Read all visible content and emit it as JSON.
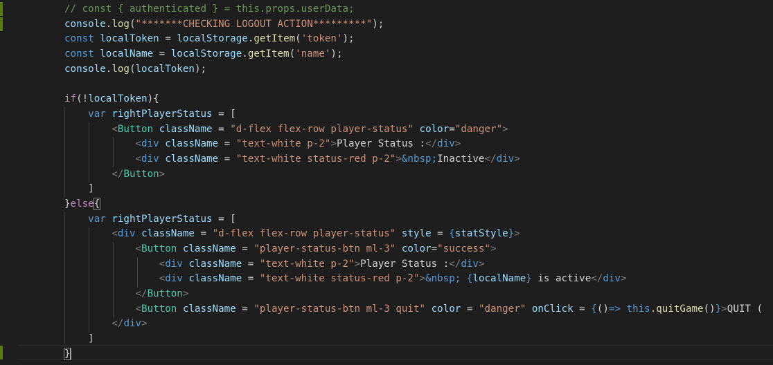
{
  "editor": {
    "language": "javascript-jsx",
    "lines": [
      {
        "indent": 0,
        "tokens": [
          {
            "c": "comment",
            "t": "// const { authenticated } = this.props.userData;"
          }
        ]
      },
      {
        "indent": 0,
        "tokens": [
          {
            "c": "var",
            "t": "console"
          },
          {
            "c": "punc",
            "t": "."
          },
          {
            "c": "fn",
            "t": "log"
          },
          {
            "c": "punc",
            "t": "("
          },
          {
            "c": "str",
            "t": "\"*******CHECKING LOGOUT ACTION*********\""
          },
          {
            "c": "punc",
            "t": ");"
          }
        ]
      },
      {
        "indent": 0,
        "tokens": [
          {
            "c": "kw",
            "t": "const"
          },
          {
            "c": "text",
            "t": " "
          },
          {
            "c": "var",
            "t": "localToken"
          },
          {
            "c": "punc",
            "t": " = "
          },
          {
            "c": "var",
            "t": "localStorage"
          },
          {
            "c": "punc",
            "t": "."
          },
          {
            "c": "fn",
            "t": "getItem"
          },
          {
            "c": "punc",
            "t": "("
          },
          {
            "c": "str",
            "t": "'token'"
          },
          {
            "c": "punc",
            "t": ");"
          }
        ]
      },
      {
        "indent": 0,
        "tokens": [
          {
            "c": "kw",
            "t": "const"
          },
          {
            "c": "text",
            "t": " "
          },
          {
            "c": "var",
            "t": "localName"
          },
          {
            "c": "punc",
            "t": " = "
          },
          {
            "c": "var",
            "t": "localStorage"
          },
          {
            "c": "punc",
            "t": "."
          },
          {
            "c": "fn",
            "t": "getItem"
          },
          {
            "c": "punc",
            "t": "("
          },
          {
            "c": "str",
            "t": "'name'"
          },
          {
            "c": "punc",
            "t": ");"
          }
        ]
      },
      {
        "indent": 0,
        "tokens": [
          {
            "c": "var",
            "t": "console"
          },
          {
            "c": "punc",
            "t": "."
          },
          {
            "c": "fn",
            "t": "log"
          },
          {
            "c": "punc",
            "t": "("
          },
          {
            "c": "var",
            "t": "localToken"
          },
          {
            "c": "punc",
            "t": ");"
          }
        ]
      },
      {
        "indent": 0,
        "tokens": []
      },
      {
        "indent": 0,
        "tokens": [
          {
            "c": "ctrl",
            "t": "if"
          },
          {
            "c": "punc",
            "t": "(!"
          },
          {
            "c": "var",
            "t": "localToken"
          },
          {
            "c": "punc",
            "t": "){"
          }
        ]
      },
      {
        "indent": 1,
        "tokens": [
          {
            "c": "kw",
            "t": "var"
          },
          {
            "c": "text",
            "t": " "
          },
          {
            "c": "var",
            "t": "rightPlayerStatus"
          },
          {
            "c": "punc",
            "t": " = ["
          }
        ]
      },
      {
        "indent": 2,
        "tokens": [
          {
            "c": "tagpunc",
            "t": "<"
          },
          {
            "c": "tag",
            "t": "Button"
          },
          {
            "c": "text",
            "t": " "
          },
          {
            "c": "attr",
            "t": "className"
          },
          {
            "c": "punc",
            "t": " = "
          },
          {
            "c": "str",
            "t": "\"d-flex flex-row player-status\""
          },
          {
            "c": "text",
            "t": " "
          },
          {
            "c": "attr",
            "t": "color"
          },
          {
            "c": "punc",
            "t": "="
          },
          {
            "c": "str",
            "t": "\"danger\""
          },
          {
            "c": "tagpunc",
            "t": ">"
          }
        ]
      },
      {
        "indent": 3,
        "tokens": [
          {
            "c": "tagpunc",
            "t": "<"
          },
          {
            "c": "kw",
            "t": "div"
          },
          {
            "c": "text",
            "t": " "
          },
          {
            "c": "attr",
            "t": "className"
          },
          {
            "c": "punc",
            "t": " = "
          },
          {
            "c": "str",
            "t": "\"text-white p-2\""
          },
          {
            "c": "tagpunc",
            "t": ">"
          },
          {
            "c": "text",
            "t": "Player Status :"
          },
          {
            "c": "tagpunc",
            "t": "</"
          },
          {
            "c": "kw",
            "t": "div"
          },
          {
            "c": "tagpunc",
            "t": ">"
          }
        ]
      },
      {
        "indent": 3,
        "tokens": [
          {
            "c": "tagpunc",
            "t": "<"
          },
          {
            "c": "kw",
            "t": "div"
          },
          {
            "c": "text",
            "t": " "
          },
          {
            "c": "attr",
            "t": "className"
          },
          {
            "c": "punc",
            "t": " = "
          },
          {
            "c": "str",
            "t": "\"text-white status-red p-2\""
          },
          {
            "c": "tagpunc",
            "t": ">"
          },
          {
            "c": "entity",
            "t": "&nbsp;"
          },
          {
            "c": "text",
            "t": "Inactive"
          },
          {
            "c": "tagpunc",
            "t": "</"
          },
          {
            "c": "kw",
            "t": "div"
          },
          {
            "c": "tagpunc",
            "t": ">"
          }
        ]
      },
      {
        "indent": 2,
        "tokens": [
          {
            "c": "tagpunc",
            "t": "</"
          },
          {
            "c": "tag",
            "t": "Button"
          },
          {
            "c": "tagpunc",
            "t": ">"
          }
        ]
      },
      {
        "indent": 1,
        "tokens": [
          {
            "c": "punc",
            "t": "]"
          }
        ]
      },
      {
        "indent": 0,
        "tokens": [
          {
            "c": "punc",
            "t": "}"
          },
          {
            "c": "ctrl",
            "t": "else"
          },
          {
            "c": "punc",
            "t": "{",
            "match": true
          }
        ]
      },
      {
        "indent": 1,
        "tokens": [
          {
            "c": "kw",
            "t": "var"
          },
          {
            "c": "text",
            "t": " "
          },
          {
            "c": "var",
            "t": "rightPlayerStatus"
          },
          {
            "c": "punc",
            "t": " = ["
          }
        ]
      },
      {
        "indent": 2,
        "tokens": [
          {
            "c": "tagpunc",
            "t": "<"
          },
          {
            "c": "kw",
            "t": "div"
          },
          {
            "c": "text",
            "t": " "
          },
          {
            "c": "attr",
            "t": "className"
          },
          {
            "c": "punc",
            "t": " = "
          },
          {
            "c": "str",
            "t": "\"d-flex flex-row player-status\""
          },
          {
            "c": "text",
            "t": " "
          },
          {
            "c": "attr",
            "t": "style"
          },
          {
            "c": "punc",
            "t": " = "
          },
          {
            "c": "brace",
            "t": "{"
          },
          {
            "c": "var",
            "t": "statStyle"
          },
          {
            "c": "brace",
            "t": "}"
          },
          {
            "c": "tagpunc",
            "t": ">"
          }
        ]
      },
      {
        "indent": 3,
        "tokens": [
          {
            "c": "tagpunc",
            "t": "<"
          },
          {
            "c": "tag",
            "t": "Button"
          },
          {
            "c": "text",
            "t": " "
          },
          {
            "c": "attr",
            "t": "className"
          },
          {
            "c": "punc",
            "t": " = "
          },
          {
            "c": "str",
            "t": "\"player-status-btn ml-3\""
          },
          {
            "c": "text",
            "t": " "
          },
          {
            "c": "attr",
            "t": "color"
          },
          {
            "c": "punc",
            "t": "="
          },
          {
            "c": "str",
            "t": "\"success\""
          },
          {
            "c": "tagpunc",
            "t": ">"
          }
        ]
      },
      {
        "indent": 4,
        "tokens": [
          {
            "c": "tagpunc",
            "t": "<"
          },
          {
            "c": "kw",
            "t": "div"
          },
          {
            "c": "text",
            "t": " "
          },
          {
            "c": "attr",
            "t": "className"
          },
          {
            "c": "punc",
            "t": " = "
          },
          {
            "c": "str",
            "t": "\"text-white p-2\""
          },
          {
            "c": "tagpunc",
            "t": ">"
          },
          {
            "c": "text",
            "t": "Player Status :"
          },
          {
            "c": "tagpunc",
            "t": "</"
          },
          {
            "c": "kw",
            "t": "div"
          },
          {
            "c": "tagpunc",
            "t": ">"
          }
        ]
      },
      {
        "indent": 4,
        "tokens": [
          {
            "c": "tagpunc",
            "t": "<"
          },
          {
            "c": "kw",
            "t": "div"
          },
          {
            "c": "text",
            "t": " "
          },
          {
            "c": "attr",
            "t": "className"
          },
          {
            "c": "punc",
            "t": " = "
          },
          {
            "c": "str",
            "t": "\"text-white status-red p-2\""
          },
          {
            "c": "tagpunc",
            "t": ">"
          },
          {
            "c": "entity",
            "t": "&nbsp;"
          },
          {
            "c": "text",
            "t": " "
          },
          {
            "c": "brace",
            "t": "{"
          },
          {
            "c": "var",
            "t": "localName"
          },
          {
            "c": "brace",
            "t": "}"
          },
          {
            "c": "text",
            "t": " is active"
          },
          {
            "c": "tagpunc",
            "t": "</"
          },
          {
            "c": "kw",
            "t": "div"
          },
          {
            "c": "tagpunc",
            "t": ">"
          }
        ]
      },
      {
        "indent": 3,
        "tokens": [
          {
            "c": "tagpunc",
            "t": "</"
          },
          {
            "c": "tag",
            "t": "Button"
          },
          {
            "c": "tagpunc",
            "t": ">"
          }
        ]
      },
      {
        "indent": 3,
        "tokens": [
          {
            "c": "tagpunc",
            "t": "<"
          },
          {
            "c": "tag",
            "t": "Button"
          },
          {
            "c": "text",
            "t": " "
          },
          {
            "c": "attr",
            "t": "className"
          },
          {
            "c": "punc",
            "t": " = "
          },
          {
            "c": "str",
            "t": "\"player-status-btn ml-3 quit\""
          },
          {
            "c": "text",
            "t": " "
          },
          {
            "c": "attr",
            "t": "color"
          },
          {
            "c": "punc",
            "t": " = "
          },
          {
            "c": "str",
            "t": "\"danger\""
          },
          {
            "c": "text",
            "t": " "
          },
          {
            "c": "attr",
            "t": "onClick"
          },
          {
            "c": "punc",
            "t": " = "
          },
          {
            "c": "brace",
            "t": "{"
          },
          {
            "c": "punc",
            "t": "()"
          },
          {
            "c": "kw",
            "t": "=>"
          },
          {
            "c": "text",
            "t": " "
          },
          {
            "c": "kw",
            "t": "this"
          },
          {
            "c": "punc",
            "t": "."
          },
          {
            "c": "fn",
            "t": "quitGame"
          },
          {
            "c": "punc",
            "t": "()"
          },
          {
            "c": "brace",
            "t": "}"
          },
          {
            "c": "tagpunc",
            "t": ">"
          },
          {
            "c": "text",
            "t": "QUIT ("
          }
        ]
      },
      {
        "indent": 2,
        "tokens": [
          {
            "c": "tagpunc",
            "t": "</"
          },
          {
            "c": "kw",
            "t": "div"
          },
          {
            "c": "tagpunc",
            "t": ">"
          }
        ]
      },
      {
        "indent": 1,
        "tokens": [
          {
            "c": "punc",
            "t": "]"
          }
        ]
      },
      {
        "indent": 0,
        "tokens": [
          {
            "c": "punc",
            "t": "}",
            "match": true
          },
          {
            "c": "cursor",
            "t": ""
          }
        ]
      }
    ]
  }
}
